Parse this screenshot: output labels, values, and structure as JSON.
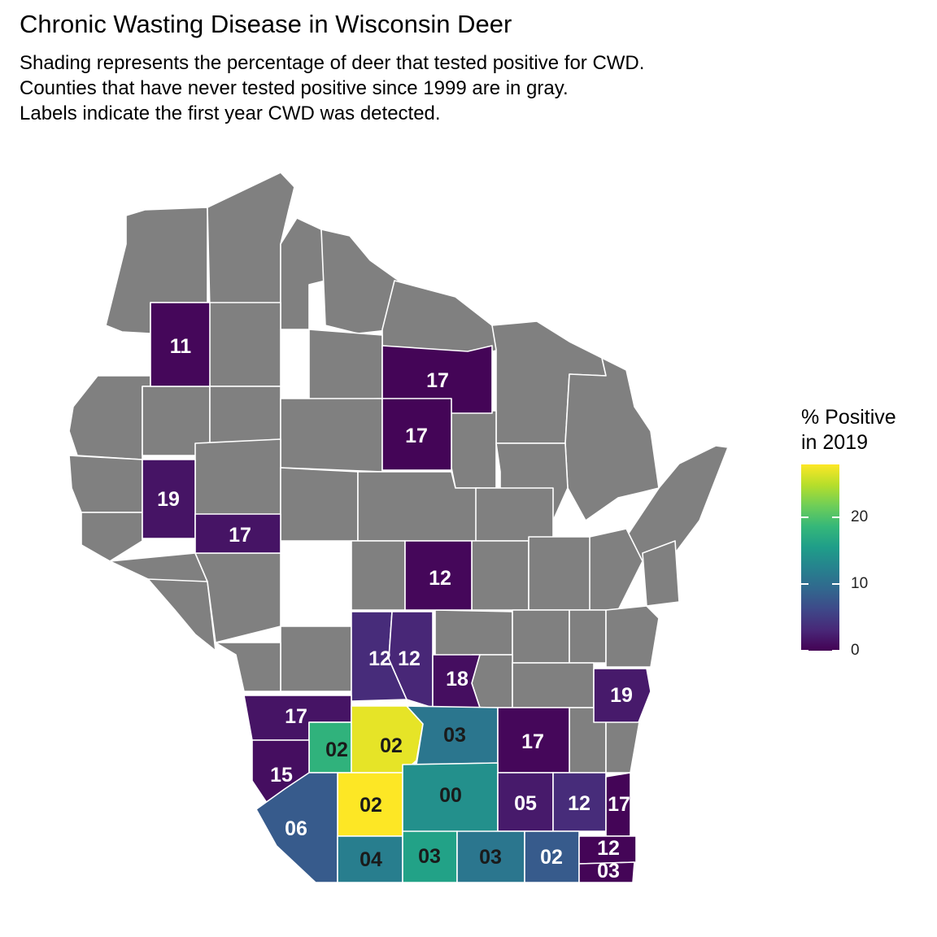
{
  "title": "Chronic Wasting Disease in Wisconsin Deer",
  "subtitle": [
    "Shading represents the percentage of deer that tested positive for CWD.",
    "Counties that have never tested positive since 1999 are in gray.",
    "Labels indicate the first year CWD was detected."
  ],
  "legend": {
    "title_line1": "% Positive",
    "title_line2": "in 2019",
    "ticks": [
      "0",
      "10",
      "20"
    ],
    "tick_values": [
      0,
      10,
      20
    ],
    "range": [
      0,
      28
    ],
    "palette": [
      "#440154",
      "#482878",
      "#3e4989",
      "#31688e",
      "#26828e",
      "#1f9e89",
      "#35b779",
      "#6ece58",
      "#b5de2b",
      "#fde725"
    ]
  },
  "colors": {
    "never_positive": "#808080",
    "border": "#ffffff",
    "label_light": "#ffffff",
    "label_dark": "#1a1a1a"
  },
  "counties": [
    {
      "name": "washburn",
      "label": "11",
      "pct": 0.5
    },
    {
      "name": "lincoln",
      "label": "17",
      "pct": 0.3
    },
    {
      "name": "marathon-north",
      "label": "17",
      "pct": 0.3
    },
    {
      "name": "pepin",
      "label": "19",
      "pct": 1.5
    },
    {
      "name": "eau-claire",
      "label": "17",
      "pct": 1.5
    },
    {
      "name": "adams",
      "label": "12",
      "pct": 0.5
    },
    {
      "name": "juneau",
      "label": "12",
      "pct": 3.5
    },
    {
      "name": "sauk-north",
      "label": "12",
      "pct": 3.0
    },
    {
      "name": "columbia",
      "label": "18",
      "pct": 1.0
    },
    {
      "name": "sheboygan",
      "label": "19",
      "pct": 2.0
    },
    {
      "name": "vernon",
      "label": "17",
      "pct": 1.5
    },
    {
      "name": "richland",
      "label": "02",
      "pct": 18.0
    },
    {
      "name": "sauk",
      "label": "02",
      "pct": 27.0
    },
    {
      "name": "dodge-west",
      "label": "03",
      "pct": 11.0
    },
    {
      "name": "dodge",
      "label": "17",
      "pct": 0.5
    },
    {
      "name": "crawford",
      "label": "15",
      "pct": 1.0
    },
    {
      "name": "iowa",
      "label": "02",
      "pct": 28.0
    },
    {
      "name": "dane",
      "label": "00",
      "pct": 14.0
    },
    {
      "name": "jefferson",
      "label": "05",
      "pct": 2.0
    },
    {
      "name": "waukesha",
      "label": "12",
      "pct": 3.5
    },
    {
      "name": "milwaukee",
      "label": "17",
      "pct": 0.3
    },
    {
      "name": "grant",
      "label": "06",
      "pct": 8.0
    },
    {
      "name": "lafayette",
      "label": "04",
      "pct": 12.0
    },
    {
      "name": "green",
      "label": "03",
      "pct": 16.0
    },
    {
      "name": "rock",
      "label": "03",
      "pct": 11.0
    },
    {
      "name": "walworth",
      "label": "02",
      "pct": 8.0
    },
    {
      "name": "racine",
      "label": "12",
      "pct": 0.3
    },
    {
      "name": "kenosha",
      "label": "03",
      "pct": 0.3
    }
  ]
}
